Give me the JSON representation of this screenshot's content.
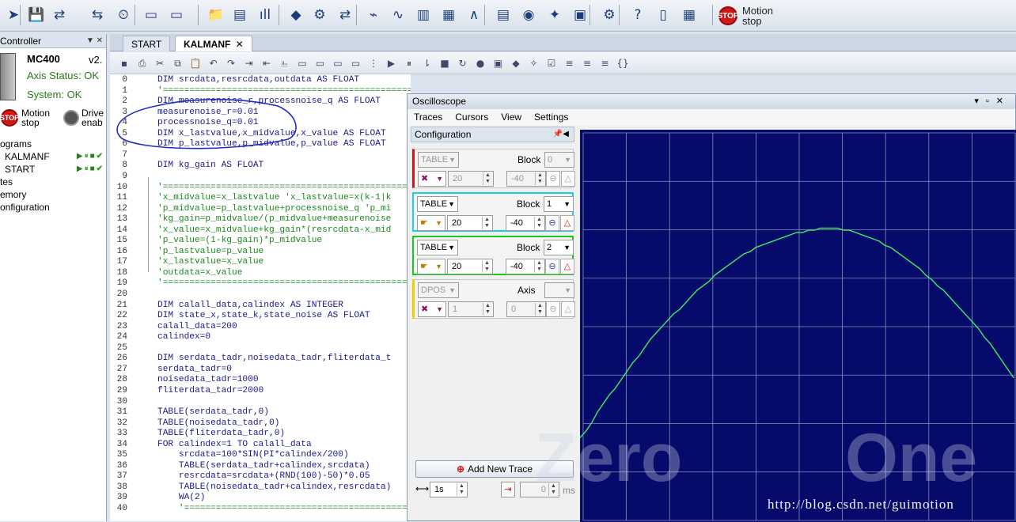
{
  "toolbar": {
    "icons": [
      "run-arrow-icon",
      "save-icon",
      "connect-icon",
      "transfer-icon",
      "clock-icon",
      "terminal-icon",
      "window-icon",
      "project-icon",
      "files-icon",
      "chart-bars-icon",
      "cube-icon",
      "robot-icon",
      "network-icon",
      "scope-icon",
      "scope-wave-icon",
      "columns-icon",
      "green-bars-icon",
      "bell-curve-icon",
      "table-icon",
      "vr-icon",
      "axis-icon",
      "display-icon",
      "gear-icon",
      "help-icon",
      "doc-icon",
      "app-icon"
    ],
    "motion_stop_line1": "Motion",
    "motion_stop_line2": "stop"
  },
  "left_panel": {
    "header": "Controller",
    "controller_name": "MC400",
    "version": "v2.",
    "axis_status": "Axis Status: OK",
    "system_status": "System: OK",
    "motion_stop_line1": "Motion",
    "motion_stop_line2": "stop",
    "drive_line1": "Drive",
    "drive_line2": "enab",
    "tree": [
      {
        "label": "ograms",
        "indent": false
      },
      {
        "label": "KALMANF",
        "indent": true
      },
      {
        "label": "START",
        "indent": true
      },
      {
        "label": "tes",
        "indent": false
      },
      {
        "label": "emory",
        "indent": false
      },
      {
        "label": "onfiguration",
        "indent": false
      }
    ]
  },
  "tabs": [
    {
      "label": "START",
      "active": false
    },
    {
      "label": "KALMANF",
      "active": true,
      "close": "✕"
    }
  ],
  "editor": {
    "lines": [
      {
        "n": "0",
        "t": "DIM srcdata,resrcdata,outdata AS FLOAT",
        "c": false
      },
      {
        "n": "1",
        "t": "'===============================================================",
        "c": true
      },
      {
        "n": "2",
        "t": "DIM measurenoise_r,processnoise_q AS FLOAT",
        "c": false
      },
      {
        "n": "3",
        "t": "measurenoise_r=0.01",
        "c": false
      },
      {
        "n": "4",
        "t": "processnoise_q=0.01",
        "c": false
      },
      {
        "n": "5",
        "t": "DIM x_lastvalue,x_midvalue,x_value AS FLOAT",
        "c": false
      },
      {
        "n": "6",
        "t": "DIM p_lastvalue,p_midvalue,p_value AS FLOAT",
        "c": false
      },
      {
        "n": "7",
        "t": "",
        "c": false
      },
      {
        "n": "8",
        "t": "DIM kg_gain AS FLOAT",
        "c": false
      },
      {
        "n": "9",
        "t": "",
        "c": false
      },
      {
        "n": "10",
        "t": "'===============================================",
        "c": true
      },
      {
        "n": "11",
        "t": "'x_midvalue=x_lastvalue 'x_lastvalue=x(k-1|k",
        "c": true
      },
      {
        "n": "12",
        "t": "'p_midvalue=p_lastvalue+processnoise_q 'p_mi",
        "c": true
      },
      {
        "n": "13",
        "t": "'kg_gain=p_midvalue/(p_midvalue+measurenoise",
        "c": true
      },
      {
        "n": "14",
        "t": "'x_value=x_midvalue+kg_gain*(resrcdata-x_mid",
        "c": true
      },
      {
        "n": "15",
        "t": "'p_value=(1-kg_gain)*p_midvalue",
        "c": true
      },
      {
        "n": "16",
        "t": "'p_lastvalue=p_value",
        "c": true
      },
      {
        "n": "17",
        "t": "'x_lastvalue=x_value",
        "c": true
      },
      {
        "n": "18",
        "t": "'outdata=x_value",
        "c": true
      },
      {
        "n": "19",
        "t": "'===============================================",
        "c": true
      },
      {
        "n": "20",
        "t": "",
        "c": false
      },
      {
        "n": "21",
        "t": "DIM calall_data,calindex AS INTEGER",
        "c": false
      },
      {
        "n": "22",
        "t": "DIM state_x,state_k,state_noise AS FLOAT",
        "c": false
      },
      {
        "n": "23",
        "t": "calall_data=200",
        "c": false
      },
      {
        "n": "24",
        "t": "calindex=0",
        "c": false
      },
      {
        "n": "25",
        "t": "",
        "c": false
      },
      {
        "n": "26",
        "t": "DIM serdata_tadr,noisedata_tadr,fliterdata_t",
        "c": false
      },
      {
        "n": "27",
        "t": "serdata_tadr=0",
        "c": false
      },
      {
        "n": "28",
        "t": "noisedata_tadr=1000",
        "c": false
      },
      {
        "n": "29",
        "t": "fliterdata_tadr=2000",
        "c": false
      },
      {
        "n": "30",
        "t": "",
        "c": false
      },
      {
        "n": "31",
        "t": "TABLE(serdata_tadr,0)",
        "c": false
      },
      {
        "n": "32",
        "t": "TABLE(noisedata_tadr,0)",
        "c": false
      },
      {
        "n": "33",
        "t": "TABLE(fliterdata_tadr,0)",
        "c": false
      },
      {
        "n": "34",
        "t": "FOR calindex=1 TO calall_data",
        "c": false
      },
      {
        "n": "35",
        "t": "    srcdata=100*SIN(PI*calindex/200)",
        "c": false
      },
      {
        "n": "36",
        "t": "    TABLE(serdata_tadr+calindex,srcdata)",
        "c": false
      },
      {
        "n": "37",
        "t": "    resrcdata=srcdata+(RND(100)-50)*0.05",
        "c": false
      },
      {
        "n": "38",
        "t": "    TABLE(noisedata_tadr+calindex,resrcdata)",
        "c": false
      },
      {
        "n": "39",
        "t": "    WA(2)",
        "c": false
      },
      {
        "n": "40",
        "t": "    '===========================================",
        "c": true
      }
    ]
  },
  "oscilloscope": {
    "title": "Oscilloscope",
    "menu": [
      "Traces",
      "Cursors",
      "View",
      "Settings"
    ],
    "config_title": "Configuration",
    "traces": [
      {
        "source": "TABLE",
        "block_label": "Block",
        "block": "0",
        "scale": "20",
        "offset": "-40",
        "enabled": false,
        "color": "#e01010"
      },
      {
        "source": "TABLE",
        "block_label": "Block",
        "block": "1",
        "scale": "20",
        "offset": "-40",
        "enabled": true,
        "color": "#19d0e6"
      },
      {
        "source": "TABLE",
        "block_label": "Block",
        "block": "2",
        "scale": "20",
        "offset": "-40",
        "enabled": true,
        "color": "#17cc17"
      },
      {
        "source": "DPOS",
        "block_label": "Axis",
        "block": "",
        "scale": "1",
        "offset": "0",
        "enabled": false,
        "color": "#f0d000"
      }
    ],
    "add_trace": "Add New Trace",
    "timebase": "1s",
    "trigger_value": "0",
    "trigger_unit": "ms",
    "plot_bg": "#050a6b",
    "trace_color": "#3cf060",
    "curve": [
      0,
      3,
      7,
      12,
      16,
      20,
      23,
      27,
      31,
      35,
      38,
      42,
      46,
      49,
      52,
      55,
      58,
      60,
      63,
      66,
      69,
      71,
      73,
      76,
      78,
      80,
      82,
      84,
      86,
      87,
      89,
      90,
      91,
      92,
      93,
      94,
      95,
      96,
      96,
      97,
      97,
      98,
      98,
      98,
      98,
      97,
      97,
      96,
      95,
      94,
      93,
      92,
      90,
      89,
      87,
      85,
      83,
      81,
      79,
      76,
      74,
      71,
      69,
      66,
      63,
      60,
      57,
      54,
      51,
      47,
      44,
      40,
      36,
      32,
      28
    ]
  },
  "watermark": {
    "text_left": "Zero",
    "text_right": "One",
    "url": "http://blog.csdn.net/guimotion"
  }
}
